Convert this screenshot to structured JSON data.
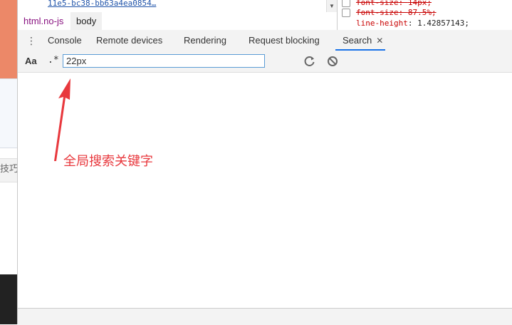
{
  "page_strip": {
    "partial_text": "技巧"
  },
  "elements": {
    "partial_link": "11e5-bc38-bb63a4ea0854…"
  },
  "breadcrumbs": [
    {
      "label": "html.no-js"
    },
    {
      "label": "body"
    }
  ],
  "styles": {
    "lines": [
      {
        "prop": "font-size",
        "value": "14px;",
        "struck": true
      },
      {
        "prop": "font-size",
        "value": "87.5%;",
        "struck": true
      },
      {
        "prop": "line-height",
        "value": "1.42857143;",
        "struck": false
      }
    ]
  },
  "drawer": {
    "tabs": [
      {
        "label": "Console"
      },
      {
        "label": "Remote devices"
      },
      {
        "label": "Rendering"
      },
      {
        "label": "Request blocking"
      },
      {
        "label": "Search",
        "active": true
      }
    ],
    "close_glyph": "✕"
  },
  "search": {
    "case_label": "Aa",
    "regex_label": ".*",
    "query": "22px"
  },
  "annotation": {
    "text": "全局搜索关键字",
    "color": "#e8383d"
  },
  "colors": {
    "accent": "#1a73e8",
    "input_border": "#5a9bd5",
    "tag": "#881280"
  }
}
